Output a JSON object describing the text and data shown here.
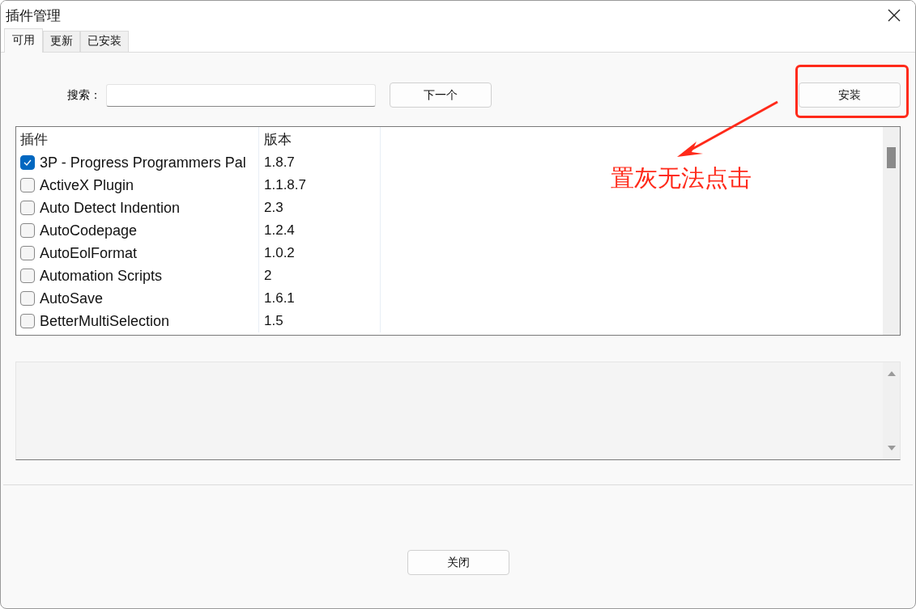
{
  "window": {
    "title": "插件管理"
  },
  "tabs": [
    {
      "label": "可用",
      "selected": true
    },
    {
      "label": "更新",
      "selected": false
    },
    {
      "label": "已安装",
      "selected": false
    }
  ],
  "search": {
    "label": "搜索："
  },
  "next_button": "下一个",
  "install_button": "安装",
  "table": {
    "columns": [
      "插件",
      "版本"
    ],
    "rows": [
      {
        "name": "3P - Progress Programmers Pal",
        "version": "1.8.7",
        "checked": true
      },
      {
        "name": "ActiveX Plugin",
        "version": "1.1.8.7",
        "checked": false
      },
      {
        "name": "Auto Detect Indention",
        "version": "2.3",
        "checked": false
      },
      {
        "name": "AutoCodepage",
        "version": "1.2.4",
        "checked": false
      },
      {
        "name": "AutoEolFormat",
        "version": "1.0.2",
        "checked": false
      },
      {
        "name": "Automation Scripts",
        "version": "2",
        "checked": false
      },
      {
        "name": "AutoSave",
        "version": "1.6.1",
        "checked": false
      },
      {
        "name": "BetterMultiSelection",
        "version": "1.5",
        "checked": false
      }
    ]
  },
  "annotation": {
    "text": "置灰无法点击"
  },
  "close_button": "关闭"
}
